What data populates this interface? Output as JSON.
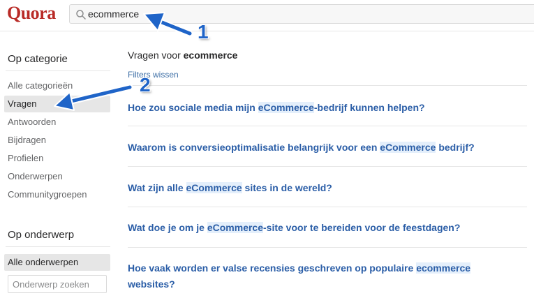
{
  "header": {
    "logo": "Quora",
    "search_value": "ecommerce"
  },
  "sidebar": {
    "category_heading": "Op categorie",
    "categories": [
      {
        "label": "Alle categorieën",
        "active": false
      },
      {
        "label": "Vragen",
        "active": true
      },
      {
        "label": "Antwoorden",
        "active": false
      },
      {
        "label": "Bijdragen",
        "active": false
      },
      {
        "label": "Profielen",
        "active": false
      },
      {
        "label": "Onderwerpen",
        "active": false
      },
      {
        "label": "Communitygroepen",
        "active": false
      }
    ],
    "topic_heading": "Op onderwerp",
    "topic_all": "Alle onderwerpen",
    "topic_placeholder": "Onderwerp zoeken"
  },
  "main": {
    "results_prefix": "Vragen voor ",
    "results_query": "ecommerce",
    "clear_filters": "Filters wissen",
    "questions": [
      {
        "before": "Hoe zou sociale media mijn ",
        "match": "eCommerce",
        "after": "-bedrijf kunnen helpen?"
      },
      {
        "before": "Waarom is conversieoptimalisatie belangrijk voor een ",
        "match": "eCommerce",
        "after": " bedrijf?"
      },
      {
        "before": "Wat zijn alle ",
        "match": "eCommerce",
        "after": " sites in de wereld?"
      },
      {
        "before": "Wat doe je om je ",
        "match": "eCommerce",
        "after": "-site voor te bereiden voor de feestdagen?"
      },
      {
        "before": "Hoe vaak worden er valse recensies geschreven op populaire ",
        "match": "ecommerce",
        "after": " websites?"
      }
    ]
  },
  "annotations": {
    "callout_1": "1",
    "callout_2": "2",
    "arrow_color": "#1f64c8"
  },
  "colors": {
    "brand": "#b92b27",
    "link": "#2b5ea7",
    "highlight": "#e4effb"
  }
}
